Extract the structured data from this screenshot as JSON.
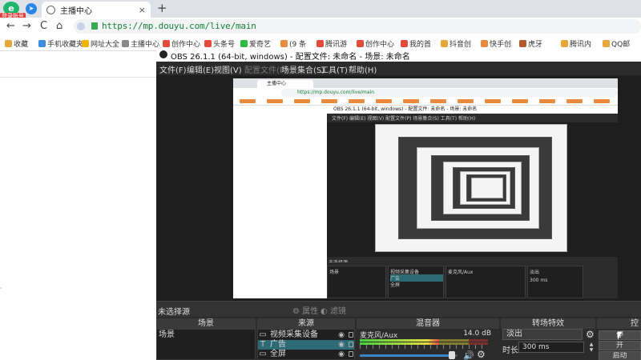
{
  "browser": {
    "app_badge": "e",
    "login_badge": "登录账号",
    "tab": {
      "title": "主播中心",
      "close": "×"
    },
    "new_tab": "+",
    "nav": {
      "back": "←",
      "forward": "→",
      "reload": "C",
      "home": "⌂"
    },
    "url": "https://mp.douyu.com/live/main",
    "bookmarks": [
      {
        "label": "收藏",
        "color": "#e8a73a"
      },
      {
        "label": "手机收藏夹",
        "color": "#3c8fe0"
      },
      {
        "label": "网址大全",
        "color": "#f0b400"
      },
      {
        "label": "主播中心",
        "color": "#888888"
      },
      {
        "label": "创作中心",
        "color": "#e34b3a"
      },
      {
        "label": "头条号",
        "color": "#e34b3a"
      },
      {
        "label": "爱奇艺",
        "color": "#2fbb3f"
      },
      {
        "label": "(9 条",
        "color": "#e98b3f"
      },
      {
        "label": "腾讯游",
        "color": "#e34b3a"
      },
      {
        "label": "创作中心",
        "color": "#e34b3a"
      },
      {
        "label": "我的首",
        "color": "#e34b3a"
      },
      {
        "label": "抖音创",
        "color": "#e8a73a"
      },
      {
        "label": "快手创",
        "color": "#e98b3f"
      },
      {
        "label": "虎牙",
        "color": "#b55a2c"
      },
      {
        "label": "腾讯内",
        "color": "#e8a73a"
      },
      {
        "label": "QQ邮",
        "color": "#e8a73a"
      }
    ]
  },
  "obs": {
    "title": "OBS 26.1.1 (64-bit, windows) - 配置文件: 未命名 - 场景: 未命名",
    "menu": [
      "文件(F)",
      "编辑(E)",
      "视图(V)",
      "配置文件(P)",
      "场景集合(S)",
      "工具(T)",
      "帮助(H)"
    ],
    "no_source_selected": "未选择源",
    "properties_btn": "属性",
    "filters_btn": "滤镜",
    "docks": {
      "scenes": "场景",
      "sources": "来源",
      "mixer": "混音器",
      "transitions": "转场特效",
      "controls": "控"
    },
    "scenes": [
      "场景"
    ],
    "sources": [
      {
        "icon": "▭",
        "label": "视频采集设备",
        "selected": false
      },
      {
        "icon": "T",
        "label": "广告",
        "selected": true
      },
      {
        "icon": "▭",
        "label": "全屏",
        "selected": false
      }
    ],
    "mixer": {
      "name": "麦克风/Aux",
      "db": "14.0 dB",
      "level": 0.62
    },
    "transitions": {
      "type": "淡出",
      "duration_label": "时长",
      "duration": "300 ms",
      "spin_up": "▲",
      "spin_down": "▼"
    },
    "controls": [
      "停",
      "开",
      "启动"
    ],
    "captured": {
      "tab": "主播中心",
      "url": "https://mp.douyu.com/live/main",
      "title": "OBS 26.1.1 (64-bit, windows) - 配置文件: 未命名 - 场景: 未命名",
      "menu": "文件(F)  编辑(E)  视图(V)  配置文件(P)  场景集合(S)  工具(T)  帮助(H)",
      "no_source": "未选择源",
      "scene": "场景",
      "sources": [
        "视频采集设备",
        "广告",
        "全屏"
      ],
      "mixer": "麦克风/Aux",
      "trans": "淡出",
      "dur": "300 ms"
    }
  }
}
